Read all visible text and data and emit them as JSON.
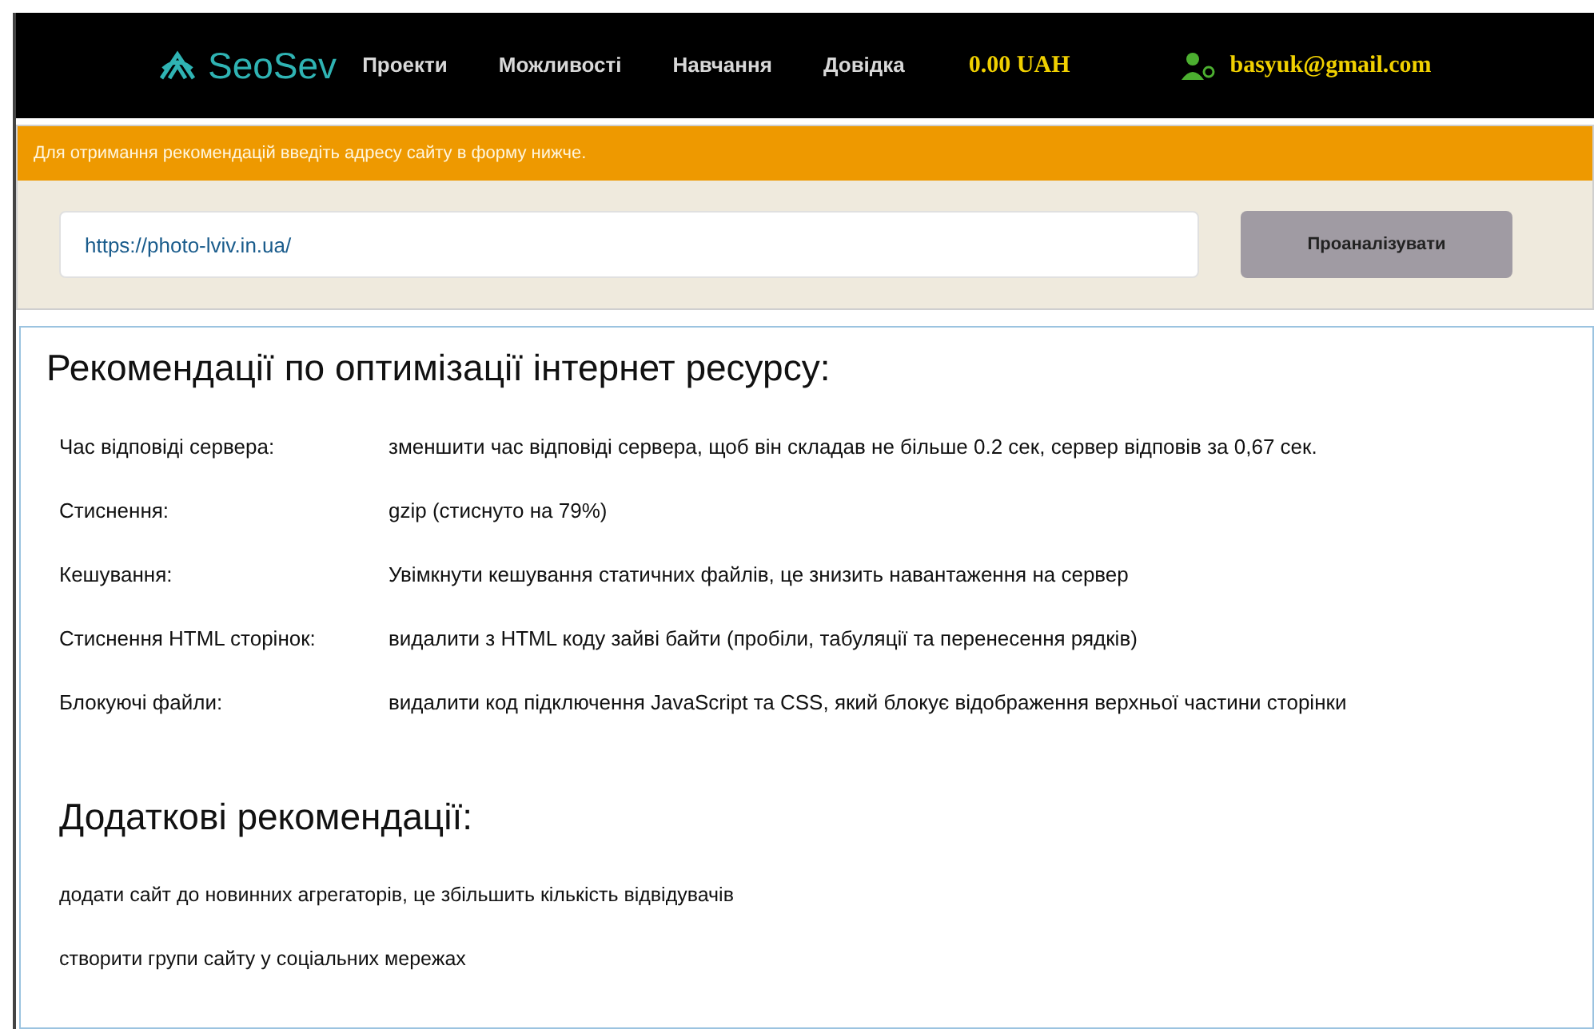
{
  "header": {
    "logo": "SeoSev",
    "nav": [
      "Проекти",
      "Можливості",
      "Навчання",
      "Довідка"
    ],
    "balance": "0.00 UAH",
    "user": "basyuk@gmail.com"
  },
  "notice": "Для отримання рекомендацій введіть адресу сайту в форму нижче.",
  "form": {
    "url": "https://photo-lviv.in.ua/",
    "button": "Проаналізувати"
  },
  "recommendations": {
    "title": "Рекомендації по оптимізації інтернет ресурсу:",
    "rows": [
      {
        "label": "Час відповіді сервера:",
        "value": "зменшити час відповіді сервера, щоб він складав не більше 0.2 сек, сервер відповів за 0,67 сек."
      },
      {
        "label": "Стиснення:",
        "value": "gzip (стиснуто на 79%)"
      },
      {
        "label": "Кешування:",
        "value": "Увімкнути кешування статичних файлів, це знизить навантаження на сервер"
      },
      {
        "label": "Стиснення HTML сторінок:",
        "value": "видалити з HTML коду зайві байти (пробіли, табуляції та перенесення рядків)"
      },
      {
        "label": "Блокуючі файли:",
        "value": "видалити код підключення JavaScript та CSS, який блокує відображення верхньої частини сторінки"
      }
    ]
  },
  "additional": {
    "title": "Додаткові рекомендації:",
    "items": [
      "додати сайт до новинних агрегаторів, це збільшить кількість відвідувачів",
      "створити групи сайту у соціальних мережах"
    ]
  }
}
